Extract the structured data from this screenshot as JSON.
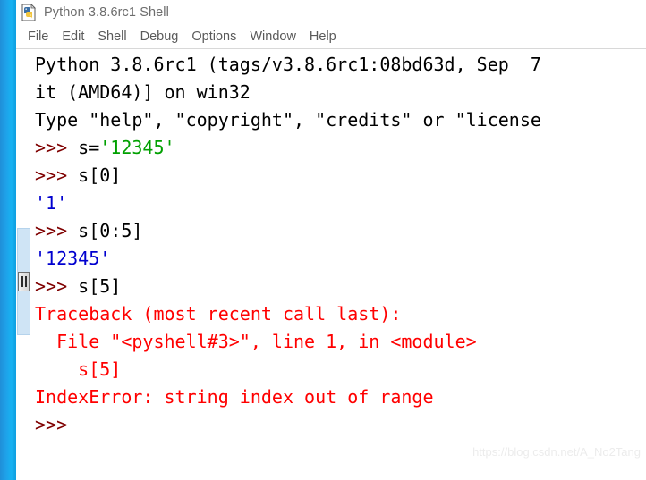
{
  "window": {
    "title": "Python 3.8.6rc1 Shell",
    "icon": "python-idle-icon"
  },
  "menubar": {
    "items": [
      {
        "label": "File"
      },
      {
        "label": "Edit"
      },
      {
        "label": "Shell"
      },
      {
        "label": "Debug"
      },
      {
        "label": "Options"
      },
      {
        "label": "Window"
      },
      {
        "label": "Help"
      }
    ]
  },
  "colors": {
    "prompt": "#7f0000",
    "string": "#00a000",
    "output": "#0000cf",
    "error": "#ff0000",
    "plain": "#000000",
    "accent_strip": "#17b2f2"
  },
  "console": {
    "lines": [
      {
        "id": "banner-1",
        "segments": [
          {
            "cls": "plain",
            "text": "Python 3.8.6rc1 (tags/v3.8.6rc1:08bd63d, Sep  7"
          }
        ]
      },
      {
        "id": "banner-2",
        "segments": [
          {
            "cls": "plain",
            "text": "it (AMD64)] on win32"
          }
        ]
      },
      {
        "id": "banner-3",
        "segments": [
          {
            "cls": "plain",
            "text": "Type \"help\", \"copyright\", \"credits\" or \"license"
          }
        ]
      },
      {
        "id": "input-1",
        "segments": [
          {
            "cls": "prompt",
            "text": ">>> "
          },
          {
            "cls": "plain",
            "text": "s="
          },
          {
            "cls": "str",
            "text": "'12345'"
          }
        ]
      },
      {
        "id": "input-2",
        "segments": [
          {
            "cls": "prompt",
            "text": ">>> "
          },
          {
            "cls": "plain",
            "text": "s[0]"
          }
        ]
      },
      {
        "id": "output-1",
        "segments": [
          {
            "cls": "out",
            "text": "'1'"
          }
        ]
      },
      {
        "id": "input-3",
        "segments": [
          {
            "cls": "prompt",
            "text": ">>> "
          },
          {
            "cls": "plain",
            "text": "s[0:5]"
          }
        ]
      },
      {
        "id": "output-2",
        "segments": [
          {
            "cls": "out",
            "text": "'12345'"
          }
        ]
      },
      {
        "id": "input-4",
        "segments": [
          {
            "cls": "prompt",
            "text": ">>> "
          },
          {
            "cls": "plain",
            "text": "s[5]"
          }
        ]
      },
      {
        "id": "trace-1",
        "segments": [
          {
            "cls": "err",
            "text": "Traceback (most recent call last):"
          }
        ]
      },
      {
        "id": "trace-2",
        "segments": [
          {
            "cls": "err",
            "text": "  File \"<pyshell#3>\", line 1, in <module>"
          }
        ]
      },
      {
        "id": "trace-3",
        "segments": [
          {
            "cls": "err",
            "text": "    s[5]"
          }
        ]
      },
      {
        "id": "trace-4",
        "segments": [
          {
            "cls": "err",
            "text": "IndexError: string index out of range"
          }
        ]
      },
      {
        "id": "input-5",
        "segments": [
          {
            "cls": "prompt",
            "text": ">>>"
          }
        ]
      }
    ]
  },
  "watermark": {
    "text": "https://blog.csdn.net/A_No2Tang"
  }
}
